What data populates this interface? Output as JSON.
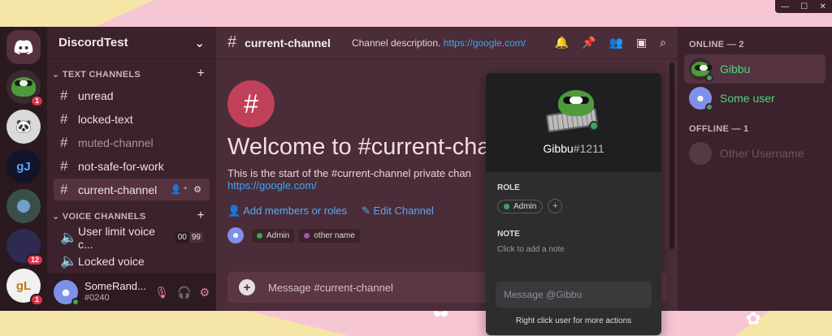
{
  "window": {
    "minimize": "—",
    "maximize": "☐",
    "close": "✕"
  },
  "servers": [
    {
      "name": "home",
      "badge": ""
    },
    {
      "name": "pepe-server",
      "badge": "1"
    },
    {
      "name": "panda-server",
      "badge": ""
    },
    {
      "name": "gj-server",
      "initials": "gJ",
      "badge": ""
    },
    {
      "name": "avatar-server",
      "badge": ""
    },
    {
      "name": "blank-server",
      "badge": "12"
    },
    {
      "name": "gl-server",
      "initials": "gL",
      "badge": "1"
    }
  ],
  "guild": {
    "name": "DiscordTest"
  },
  "categories": {
    "text": "TEXT CHANNELS",
    "voice": "VOICE CHANNELS"
  },
  "text_channels": [
    {
      "name": "unread"
    },
    {
      "name": "locked-text"
    },
    {
      "name": "muted-channel"
    },
    {
      "name": "not-safe-for-work"
    },
    {
      "name": "current-channel"
    }
  ],
  "voice_channels": [
    {
      "name": "User limit voice c...",
      "count": "00",
      "limit": "99"
    },
    {
      "name": "Locked voice"
    }
  ],
  "user": {
    "name": "SomeRand...",
    "tag": "#0240"
  },
  "topbar": {
    "channel": "current-channel",
    "description": "Channel description.",
    "link": "https://google.com/"
  },
  "chat": {
    "welcome": "Welcome to #current-chan",
    "start": "This is the start of the #current-channel private chan",
    "link": "https://google.com/",
    "add_members": "Add members or roles",
    "edit_channel": "Edit Channel",
    "roles": [
      {
        "label": "Admin",
        "color": "#3ba55d"
      },
      {
        "label": "other name",
        "color": "#9b59b6"
      }
    ],
    "message_placeholder": "Message #current-channel"
  },
  "members": {
    "online_header": "ONLINE — 2",
    "online": [
      {
        "name": "Gibbu",
        "color": "#4fd67a"
      },
      {
        "name": "Some user",
        "color": "#4fd67a"
      }
    ],
    "offline_header": "OFFLINE — 1",
    "offline": [
      {
        "name": "Other Username"
      }
    ]
  },
  "popout": {
    "username": "Gibbu",
    "discriminator": "#1211",
    "role_label": "ROLE",
    "role": "Admin",
    "role_color": "#3ba55d",
    "note_label": "NOTE",
    "note_hint": "Click to add a note",
    "message_placeholder": "Message @Gibbu",
    "footer": "Right click user for more actions"
  },
  "colors": {
    "accent": "#c04159",
    "link": "#3fa6ef",
    "online": "#3ba55d"
  }
}
